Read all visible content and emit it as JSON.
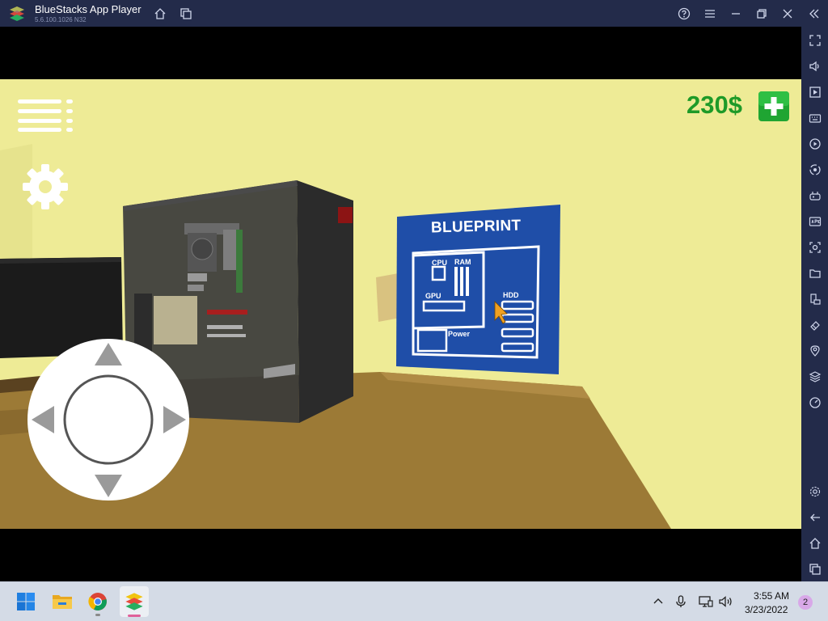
{
  "window": {
    "title": "BlueStacks App Player",
    "version": "5.6.100.1026  N32",
    "buttons": [
      "home-icon",
      "multi-instance-icon",
      "help-icon",
      "menu-icon",
      "minimize-icon",
      "restore-icon",
      "close-icon",
      "collapse-sidebar-icon"
    ]
  },
  "sidebar": {
    "top_items": [
      "fullscreen-icon",
      "volume-icon",
      "media-icon",
      "keyboard-icon",
      "record-icon",
      "macro-icon",
      "gamepad-icon",
      "apk-icon",
      "screenshot-icon",
      "folder-icon",
      "rotate-icon",
      "eraser-icon",
      "location-icon",
      "layers-icon",
      "eco-mode-icon"
    ],
    "bottom_items": [
      "settings-icon",
      "back-icon",
      "android-home-icon",
      "recent-apps-icon"
    ]
  },
  "game": {
    "money": "230$",
    "blueprint": {
      "title": "BLUEPRINT",
      "labels": {
        "cpu": "CPU",
        "ram": "RAM",
        "gpu": "GPU",
        "hdd": "HDD",
        "power": "Power"
      }
    },
    "controls": [
      "menu-icon",
      "settings-gear-icon",
      "add-money-icon",
      "joystick"
    ],
    "colors": {
      "wall": "#eeeb96",
      "floor": "#9c7a36",
      "blueprint": "#1f4ea8",
      "money": "#1e9a28"
    }
  },
  "taskbar": {
    "apps": [
      "windows-start-icon",
      "file-explorer-icon",
      "chrome-icon",
      "bluestacks-icon"
    ],
    "tray": [
      "chevron-up-icon",
      "microphone-icon",
      "network-icon",
      "speaker-icon"
    ],
    "time": "3:55 AM",
    "date": "3/23/2022",
    "notifications": "2"
  }
}
